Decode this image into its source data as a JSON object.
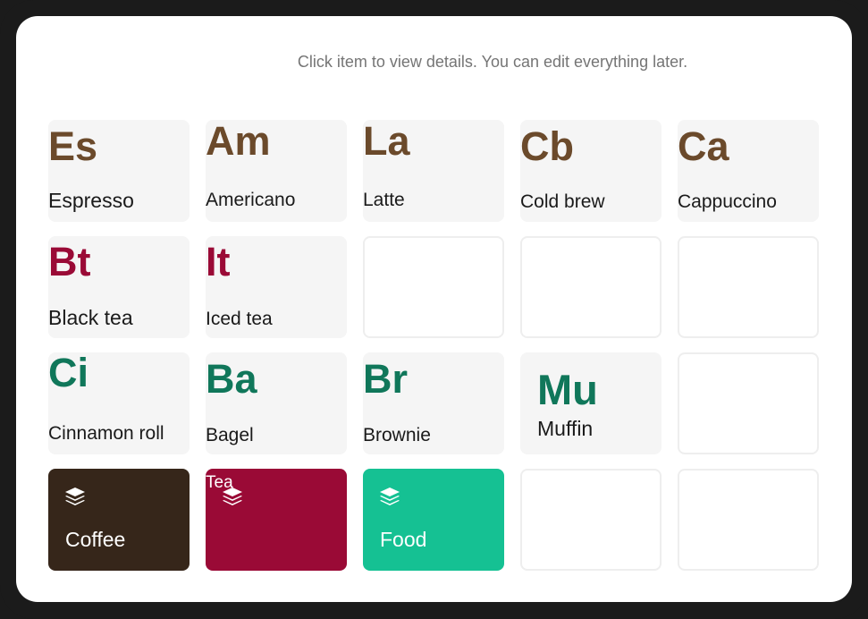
{
  "hint": "Click item to view details. You can edit everything later.",
  "colors": {
    "coffee": "#6b4a2b",
    "tea": "#9a0a36",
    "food": "#10775a",
    "coffee_category": "#36261a",
    "tea_category": "#9a0a36",
    "food_category": "#15c193"
  },
  "items": {
    "espresso": {
      "abbr": "Es",
      "name": "Espresso"
    },
    "americano": {
      "abbr": "Am",
      "name": "Americano"
    },
    "latte": {
      "abbr": "La",
      "name": "Latte"
    },
    "cold_brew": {
      "abbr": "Cb",
      "name": "Cold brew"
    },
    "cappuccino": {
      "abbr": "Ca",
      "name": "Cappuccino"
    },
    "black_tea": {
      "abbr": "Bt",
      "name": "Black tea"
    },
    "iced_tea": {
      "abbr": "It",
      "name": "Iced tea"
    },
    "cinnamon_roll": {
      "abbr": "Ci",
      "name": "Cinnamon roll"
    },
    "bagel": {
      "abbr": "Ba",
      "name": "Bagel"
    },
    "brownie": {
      "abbr": "Br",
      "name": "Brownie"
    },
    "muffin": {
      "abbr": "Mu",
      "name": "Muffin"
    }
  },
  "categories": {
    "coffee": {
      "label": "Coffee",
      "icon": "layers-icon"
    },
    "tea": {
      "label": "Tea",
      "icon": "layers-icon"
    },
    "food": {
      "label": "Food",
      "icon": "layers-icon"
    }
  }
}
